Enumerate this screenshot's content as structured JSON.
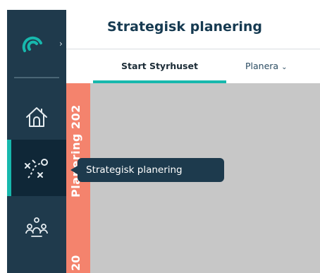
{
  "header": {
    "title": "Strategisk planering"
  },
  "tabs": [
    {
      "label": "Start Styrhuset",
      "active": true
    },
    {
      "label": "Planera",
      "has_dropdown": true
    }
  ],
  "sidebar": {
    "items": [
      {
        "icon": "home-icon"
      },
      {
        "icon": "strategy-icon",
        "active": true
      },
      {
        "icon": "people-icon"
      }
    ],
    "logo_icon": "brand-logo-icon",
    "expand_icon": "chevron-right-icon"
  },
  "strip": {
    "label": "Planering 202",
    "label_bottom": "20"
  },
  "tooltip": {
    "text": "Strategisk planering"
  },
  "colors": {
    "sidebar_bg": "#1f3a4c",
    "accent": "#17b8ad",
    "strip": "#f4836d",
    "content_bg": "#c7c7c7",
    "title": "#163a51"
  }
}
